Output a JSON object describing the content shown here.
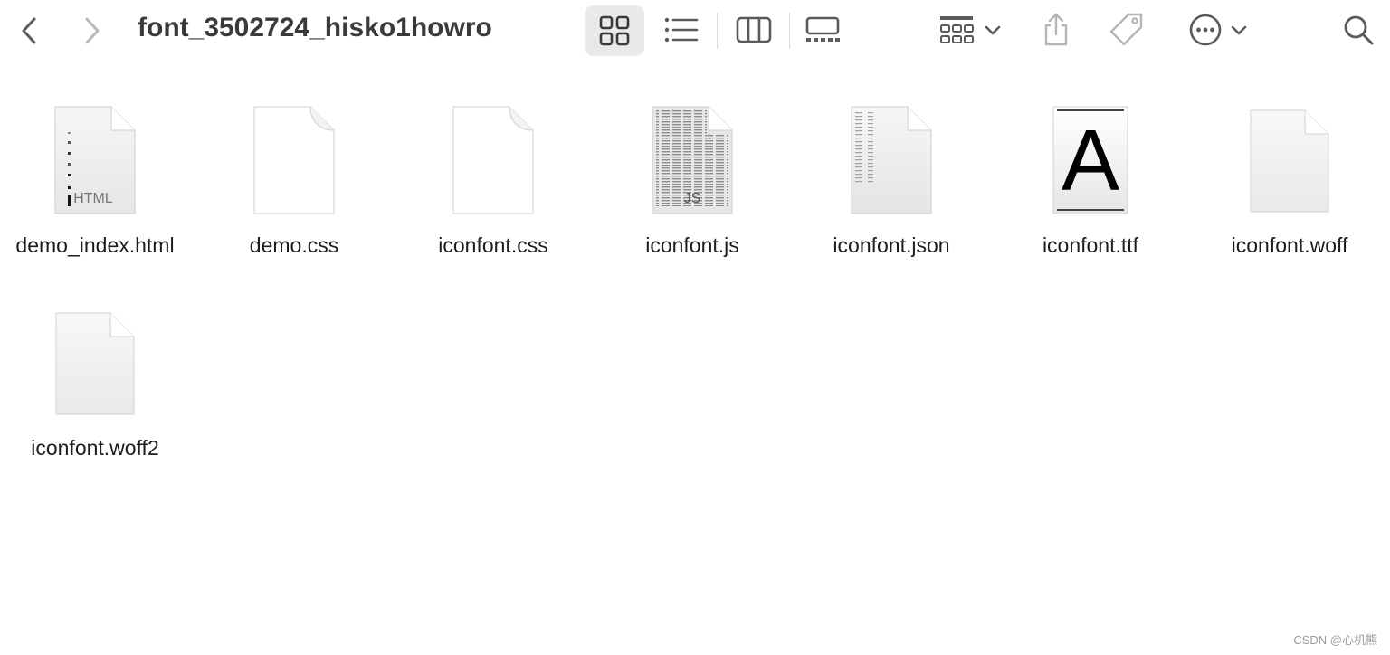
{
  "window": {
    "title": "font_3502724_hisko1howro"
  },
  "toolbar": {
    "back_icon": "chevron-left-icon",
    "forward_icon": "chevron-right-icon",
    "view_modes": [
      "icon-view",
      "list-view",
      "column-view",
      "gallery-view"
    ],
    "active_view": "icon-view",
    "group_icon": "group-by-icon",
    "share_icon": "share-icon",
    "tag_icon": "tag-icon",
    "more_icon": "ellipsis-circle-icon",
    "search_icon": "search-icon"
  },
  "files": [
    {
      "name": "demo_index.html",
      "icon": "html-file-icon",
      "badge": "HTML"
    },
    {
      "name": "demo.css",
      "icon": "blank-file-icon",
      "badge": ""
    },
    {
      "name": "iconfont.css",
      "icon": "blank-file-icon",
      "badge": ""
    },
    {
      "name": "iconfont.js",
      "icon": "js-file-icon",
      "badge": "JS"
    },
    {
      "name": "iconfont.json",
      "icon": "json-file-icon",
      "badge": ""
    },
    {
      "name": "iconfont.ttf",
      "icon": "font-file-icon",
      "badge": "A"
    },
    {
      "name": "iconfont.woff",
      "icon": "blank-file-icon",
      "badge": ""
    },
    {
      "name": "iconfont.woff2",
      "icon": "blank-file-icon",
      "badge": ""
    }
  ],
  "watermark": "CSDN @心机熊"
}
